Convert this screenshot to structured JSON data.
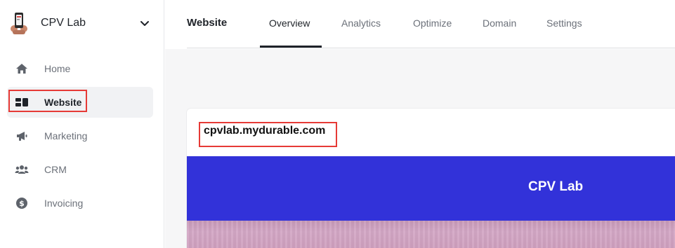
{
  "brand": {
    "name": "CPV Lab",
    "logo_icon": "brand-logo-icon",
    "chevron_icon": "chevron-down-icon"
  },
  "sidebar": {
    "items": [
      {
        "label": "Home",
        "icon": "home-icon",
        "active": false
      },
      {
        "label": "Website",
        "icon": "website-icon",
        "active": true
      },
      {
        "label": "Marketing",
        "icon": "megaphone-icon",
        "active": false
      },
      {
        "label": "CRM",
        "icon": "users-icon",
        "active": false
      },
      {
        "label": "Invoicing",
        "icon": "dollar-circle-icon",
        "active": false
      }
    ]
  },
  "topbar": {
    "title": "Website",
    "tabs": [
      {
        "label": "Overview",
        "active": true
      },
      {
        "label": "Analytics",
        "active": false
      },
      {
        "label": "Optimize",
        "active": false
      },
      {
        "label": "Domain",
        "active": false
      },
      {
        "label": "Settings",
        "active": false
      }
    ]
  },
  "site": {
    "url": "cpvlab.mydurable.com",
    "preview_title": "CPV Lab"
  },
  "colors": {
    "accent_highlight": "#e63a36",
    "preview_header": "#3232d9",
    "text_primary": "#1f2329",
    "text_muted": "#6b7079"
  }
}
